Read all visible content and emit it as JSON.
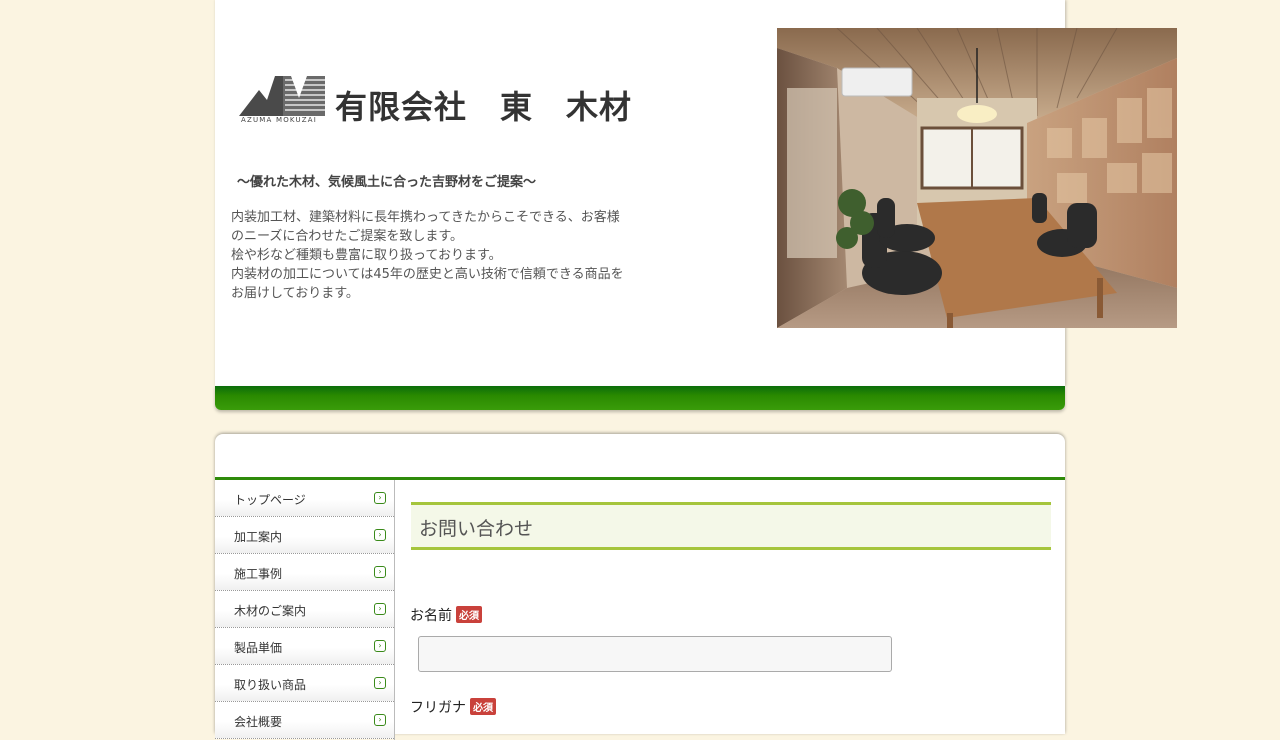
{
  "header": {
    "logo_sub": "AZUMA MOKUZAI",
    "company_name": "有限会社　東　木材",
    "tagline": "～優れた木材、気候風土に合った吉野材をご提案～",
    "intro_lines": [
      "内装加工材、建築材料に長年携わってきたからこそできる、お客様のニーズに合わせたご提案を致します。",
      "桧や杉など種類も豊富に取り扱っております。",
      "内装材の加工については45年の歴史と高い技術で信頼できる商品をお届けしております。"
    ]
  },
  "nav": {
    "items": [
      {
        "label": "トップページ"
      },
      {
        "label": "加工案内"
      },
      {
        "label": "施工事例"
      },
      {
        "label": "木材のご案内"
      },
      {
        "label": "製品単価"
      },
      {
        "label": "取り扱い商品"
      },
      {
        "label": "会社概要"
      }
    ]
  },
  "page": {
    "title": "お問い合わせ"
  },
  "form": {
    "name_label": "お名前",
    "furigana_label": "フリガナ",
    "required_badge": "必須",
    "name_value": ""
  },
  "colors": {
    "background": "#fbf4e1",
    "green_bar": "#2a8a00",
    "title_border": "#a5c53c",
    "required_badge": "#c9413b"
  }
}
